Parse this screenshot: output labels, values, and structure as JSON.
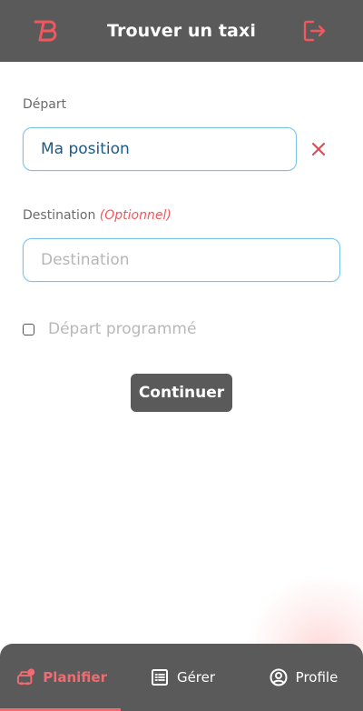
{
  "header": {
    "title": "Trouver un taxi",
    "logo_icon": "brand-logo-icon",
    "logout_icon": "logout-icon"
  },
  "form": {
    "departure": {
      "label": "Départ",
      "value": "Ma position",
      "clear_icon": "close-icon"
    },
    "destination": {
      "label": "Destination",
      "optional_label": "(Optionnel)",
      "placeholder": "Destination",
      "value": ""
    },
    "scheduled": {
      "label": "Départ programmé",
      "checked": false
    },
    "continue_label": "Continuer"
  },
  "bottom_nav": {
    "items": [
      {
        "label": "Planifier",
        "icon": "taxi-booking-icon",
        "active": true
      },
      {
        "label": "Gérer",
        "icon": "list-icon",
        "active": false
      },
      {
        "label": "Profile",
        "icon": "user-circle-icon",
        "active": false
      }
    ]
  },
  "colors": {
    "header_bg": "#5a5a5a",
    "accent": "#f26b70",
    "input_border": "#7cc3ea",
    "input_text": "#1d5a86"
  }
}
